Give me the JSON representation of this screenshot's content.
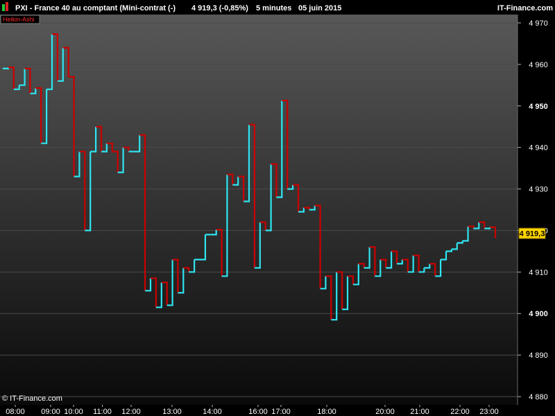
{
  "header": {
    "title": "PXI - France 40 au comptant (Mini-contrat  (-)",
    "quote": "4 919,3 (-0,85%)",
    "interval": "5 minutes",
    "date": "05 juin 2015",
    "brand": "IT-Finance.com"
  },
  "legend_label": "Heikin-Ashi",
  "copyright": "© IT-Finance.com",
  "colors": {
    "up": "#2ee6f2",
    "down": "#cc0000",
    "grid": "#4a4a4a",
    "price_box": "#ffd400"
  },
  "chart_data": {
    "type": "line",
    "style": "step",
    "x_labels": [
      "08:00",
      "09:00",
      "10:00",
      "11:00",
      "12:00",
      "13:00",
      "14:00",
      "16:00",
      "17:00",
      "18:00",
      "20:00",
      "21:00",
      "22:00",
      "23:00"
    ],
    "y_ticks": [
      "4 880",
      "4 890",
      "4 900",
      "4 910",
      "4 920",
      "4 930",
      "4 940",
      "4 950",
      "4 960",
      "4 970"
    ],
    "y_major": [
      "4 900",
      "4 950"
    ],
    "ylim": [
      4878,
      4972
    ],
    "grid": true,
    "last_price": "4 919,3",
    "series": [
      {
        "values": [
          4959,
          4959.3,
          4954,
          4955,
          4959,
          4953,
          4954.3,
          4941,
          4954,
          4967.3,
          4956,
          4964,
          4957,
          4933,
          4939,
          4920,
          4939,
          4945,
          4939,
          4941,
          4939,
          4934,
          4940,
          4939,
          4939,
          4943,
          4905.5,
          4908.5,
          4901.5,
          4907.5,
          4902,
          4913,
          4905,
          4911,
          4910,
          4913,
          4913,
          4919,
          4919,
          4920.2,
          4909,
          4933.5,
          4931,
          4933,
          4927,
          4945.5,
          4911,
          4922,
          4920,
          4936,
          4928,
          4951.3,
          4930,
          4931,
          4924.5,
          4925.5,
          4925,
          4926,
          4906,
          4909,
          4898.5,
          4910,
          4901,
          4909,
          4907,
          4912,
          4911,
          4916,
          4909,
          4913,
          4911,
          4915,
          4912,
          4913,
          4910,
          4914,
          4910,
          4911,
          4912,
          4909,
          4913,
          4915,
          4915.5,
          4917,
          4917.5,
          4921,
          4920.5,
          4922,
          4920.5,
          4920.8,
          4919.3
        ]
      }
    ]
  }
}
